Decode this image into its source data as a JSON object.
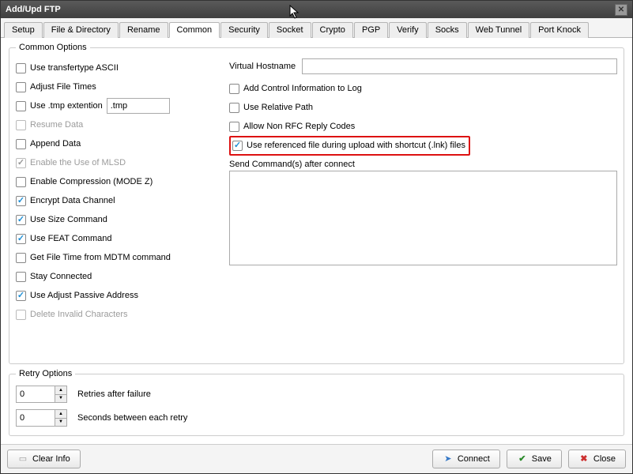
{
  "window": {
    "title": "Add/Upd FTP"
  },
  "tabs": [
    "Setup",
    "File & Directory",
    "Rename",
    "Common",
    "Security",
    "Socket",
    "Crypto",
    "PGP",
    "Verify",
    "Socks",
    "Web Tunnel",
    "Port Knock"
  ],
  "activeTab": "Common",
  "group": {
    "common": "Common Options",
    "retry": "Retry Options"
  },
  "left": {
    "transferAscii": "Use transfertype ASCII",
    "adjustTimes": "Adjust File Times",
    "useTmpExt": "Use .tmp extention",
    "tmpExtValue": ".tmp",
    "resumeData": "Resume Data",
    "appendData": "Append Data",
    "enableMlsd": "Enable the Use of MLSD",
    "enableCompression": "Enable Compression (MODE Z)",
    "encryptData": "Encrypt Data Channel",
    "useSize": "Use Size Command",
    "useFeat": "Use FEAT Command",
    "getFileTimeMdtm": "Get File Time from MDTM command",
    "stayConnected": "Stay Connected",
    "usePassive": "Use Adjust Passive Address",
    "deleteInvalid": "Delete Invalid Characters"
  },
  "right": {
    "virtualHostLabel": "Virtual Hostname",
    "virtualHostValue": "",
    "addControlInfo": "Add Control Information to Log",
    "useRelative": "Use Relative Path",
    "allowNonRfc": "Allow Non RFC Reply Codes",
    "useReferenced": "Use referenced file during upload with shortcut (.lnk) files",
    "sendCmdLabel": "Send Command(s) after connect",
    "sendCmdValue": ""
  },
  "retry": {
    "retriesValue": "0",
    "retriesLabel": "Retries after failure",
    "secondsValue": "0",
    "secondsLabel": "Seconds between each retry"
  },
  "footer": {
    "clearInfo": "Clear Info",
    "connect": "Connect",
    "save": "Save",
    "close": "Close"
  }
}
